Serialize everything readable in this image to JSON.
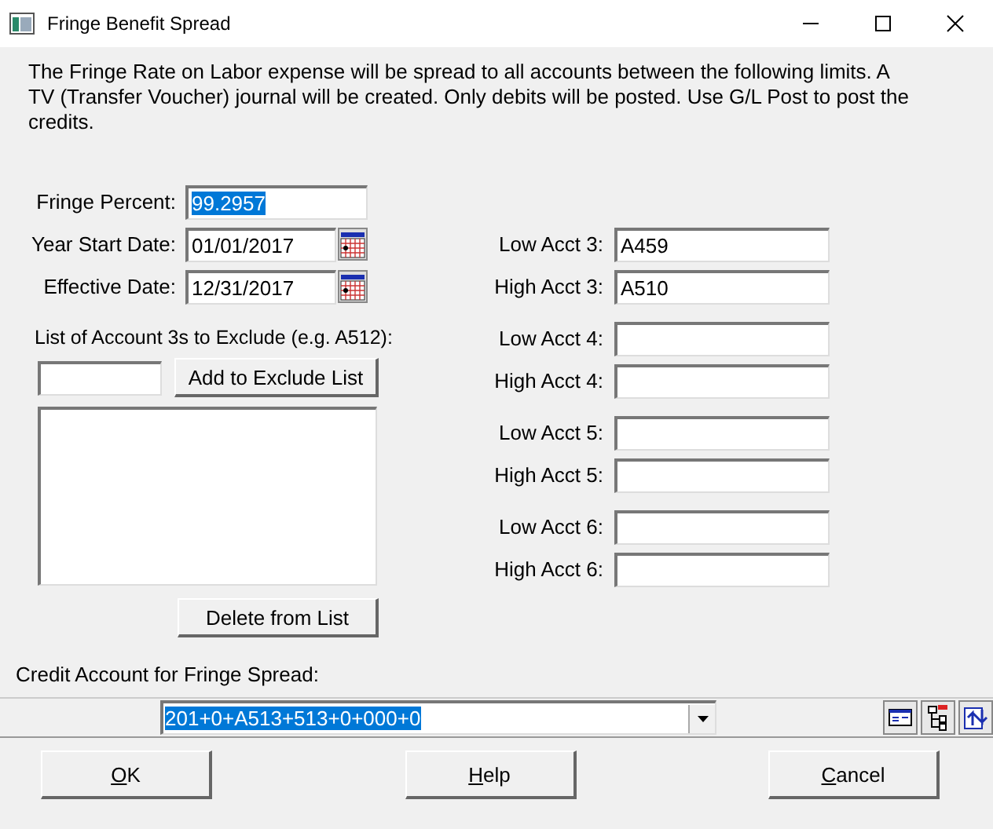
{
  "window": {
    "title": "Fringe Benefit Spread"
  },
  "description": "The Fringe Rate on Labor expense will be spread to all accounts between the following limits. A TV (Transfer Voucher) journal will be created. Only debits will be posted. Use G/L Post to post the credits.",
  "fringe_percent": {
    "label": "Fringe Percent:",
    "value": "99.2957",
    "selected": true
  },
  "dates": [
    {
      "label": "Year Start Date:",
      "value": "01/01/2017"
    },
    {
      "label": "Effective Date:",
      "value": "12/31/2017"
    }
  ],
  "exclude": {
    "label": "List of Account 3s to Exclude (e.g. A512):",
    "add_button": "Add to Exclude List",
    "delete_button": "Delete from List"
  },
  "account_ranges": [
    {
      "low_label": "Low Acct 3:",
      "low_value": "A459",
      "high_label": "High Acct 3:",
      "high_value": "A510"
    },
    {
      "low_label": "Low Acct 4:",
      "high_label": "High Acct 4:"
    },
    {
      "low_label": "Low Acct 5:",
      "high_label": "High Acct 5:"
    },
    {
      "low_label": "Low Acct 6:",
      "high_label": "High Acct 6:"
    }
  ],
  "credit_account": {
    "label": "Credit Account for Fringe Spread:",
    "value": "201+0+A513+513+0+000+0",
    "selected": true
  },
  "buttons": [
    {
      "key": "O",
      "rest": "K"
    },
    {
      "key": "H",
      "rest": "elp"
    },
    {
      "key": "C",
      "rest": "ancel"
    }
  ]
}
